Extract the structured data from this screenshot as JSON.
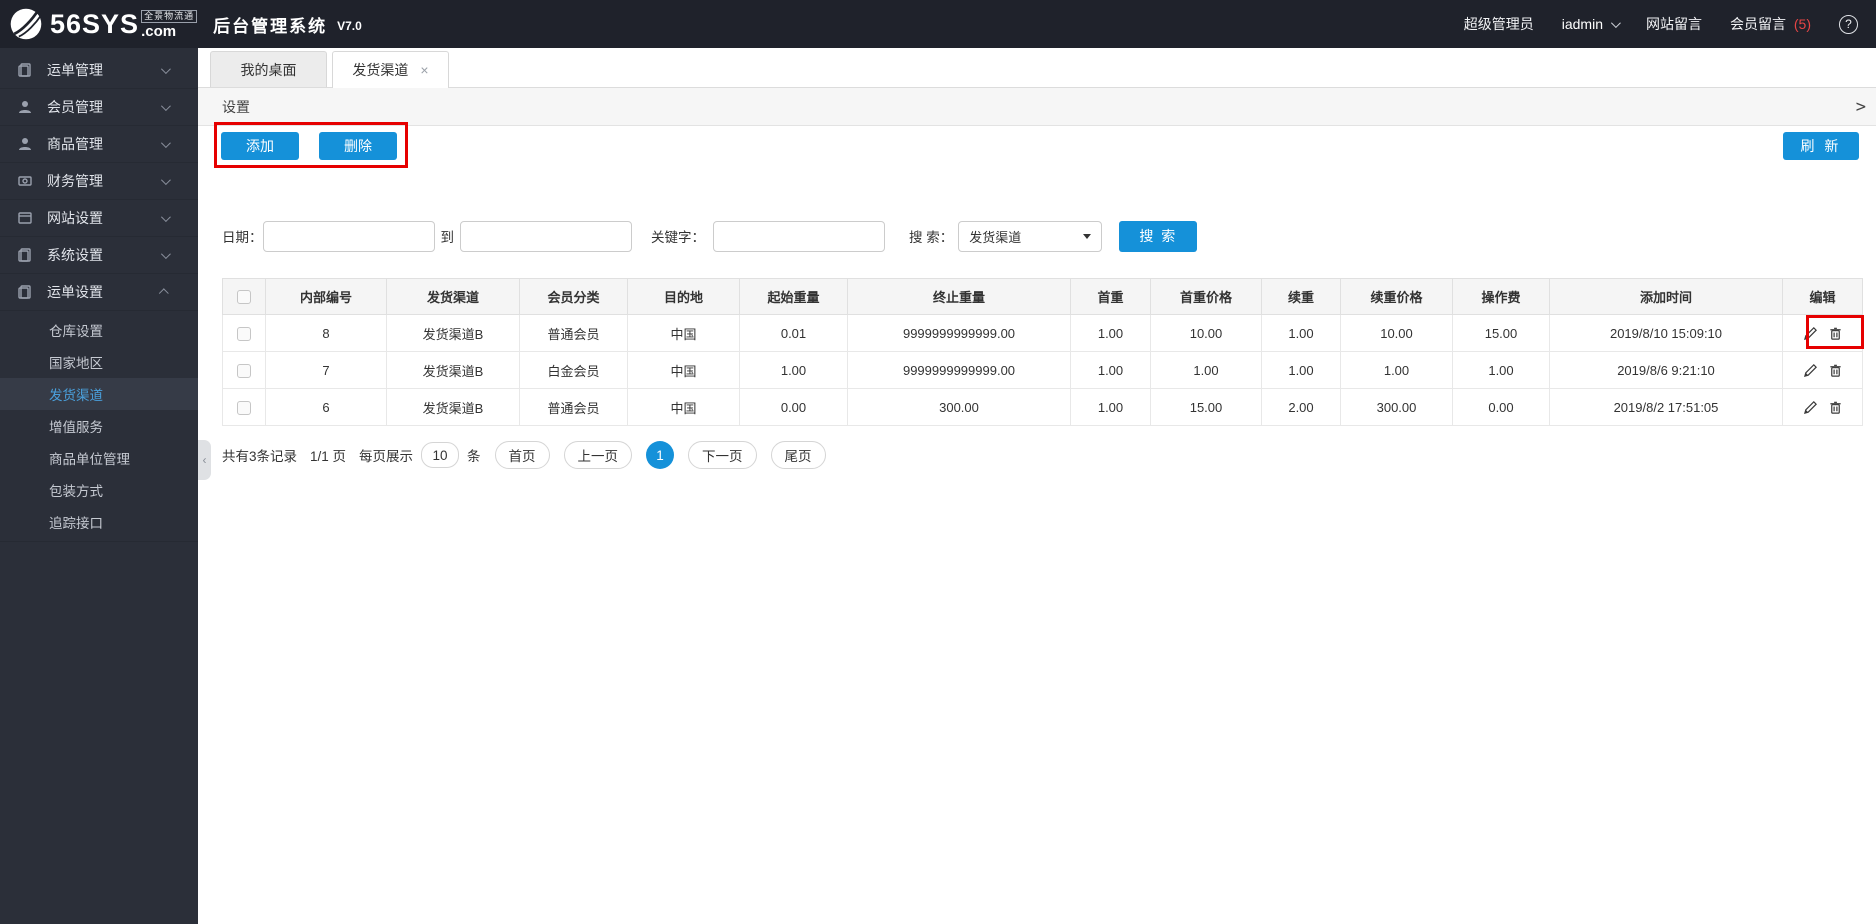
{
  "header": {
    "logo_main": "56SYS",
    "logo_tagline": "全景物流通",
    "logo_com": ".com",
    "app_title": "后台管理系统",
    "version": "V7.0",
    "role": "超级管理员",
    "username": "iadmin",
    "site_messages": "网站留言",
    "member_messages": "会员留言",
    "member_message_count": "(5)",
    "help_glyph": "?"
  },
  "sidebar": {
    "items": [
      {
        "label": "运单管理",
        "icon": "document-icon"
      },
      {
        "label": "会员管理",
        "icon": "user-icon"
      },
      {
        "label": "商品管理",
        "icon": "user-icon"
      },
      {
        "label": "财务管理",
        "icon": "money-icon"
      },
      {
        "label": "网站设置",
        "icon": "window-icon"
      },
      {
        "label": "系统设置",
        "icon": "document-icon"
      },
      {
        "label": "运单设置",
        "icon": "document-icon"
      }
    ],
    "submenu": [
      {
        "label": "仓库设置"
      },
      {
        "label": "国家地区"
      },
      {
        "label": "发货渠道"
      },
      {
        "label": "增值服务"
      },
      {
        "label": "商品单位管理"
      },
      {
        "label": "包装方式"
      },
      {
        "label": "追踪接口"
      }
    ]
  },
  "tabs": [
    {
      "label": "我的桌面"
    },
    {
      "label": "发货渠道"
    }
  ],
  "icons": {
    "close": "×",
    "collapse": "‹"
  },
  "panel": {
    "title": "设置",
    "expand": ">"
  },
  "toolbar": {
    "add": "添加",
    "delete": "删除",
    "refresh": "刷 新"
  },
  "filters": {
    "date_label": "日期：",
    "to_label": "到",
    "keyword_label": "关键字：",
    "search_label": "搜 索：",
    "search_select_value": "发货渠道",
    "search_button": "搜 索"
  },
  "table": {
    "columns": [
      "内部编号",
      "发货渠道",
      "会员分类",
      "目的地",
      "起始重量",
      "终止重量",
      "首重",
      "首重价格",
      "续重",
      "续重价格",
      "操作费",
      "添加时间",
      "编辑"
    ],
    "rows": [
      {
        "id": "8",
        "channel": "发货渠道B",
        "member_class": "普通会员",
        "destination": "中国",
        "start_weight": "0.01",
        "end_weight": "9999999999999.00",
        "first_weight": "1.00",
        "first_price": "10.00",
        "cont_weight": "1.00",
        "cont_price": "10.00",
        "operation_fee": "15.00",
        "add_time": "2019/8/10 15:09:10"
      },
      {
        "id": "7",
        "channel": "发货渠道B",
        "member_class": "白金会员",
        "destination": "中国",
        "start_weight": "1.00",
        "end_weight": "9999999999999.00",
        "first_weight": "1.00",
        "first_price": "1.00",
        "cont_weight": "1.00",
        "cont_price": "1.00",
        "operation_fee": "1.00",
        "add_time": "2019/8/6 9:21:10"
      },
      {
        "id": "6",
        "channel": "发货渠道B",
        "member_class": "普通会员",
        "destination": "中国",
        "start_weight": "0.00",
        "end_weight": "300.00",
        "first_weight": "1.00",
        "first_price": "15.00",
        "cont_weight": "2.00",
        "cont_price": "300.00",
        "operation_fee": "0.00",
        "add_time": "2019/8/2 17:51:05"
      }
    ]
  },
  "pagination": {
    "total": "共有3条记录",
    "page_info": "1/1 页",
    "per_page_label": "每页展示",
    "per_page_value": "10",
    "unit": "条",
    "first": "首页",
    "prev": "上一页",
    "current": "1",
    "next": "下一页",
    "last": "尾页"
  },
  "colors": {
    "accent_blue": "#1591d9",
    "annotation_red": "#e60000",
    "header_bg": "#1f222b",
    "sidebar_bg": "#2b2f39",
    "active_link_blue": "#4aa0dc",
    "message_count_red": "#e64545"
  }
}
